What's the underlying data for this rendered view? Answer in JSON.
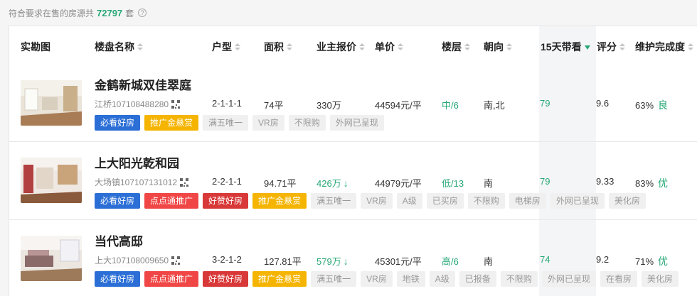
{
  "summary": {
    "prefix": "符合要求在售的房源共",
    "count": "72797",
    "suffix": "套",
    "help_icon": "?"
  },
  "columns": [
    {
      "label": "实勘图",
      "sortable": false
    },
    {
      "label": "楼盘名称",
      "sortable": true
    },
    {
      "label": "户型",
      "sortable": true
    },
    {
      "label": "面积",
      "sortable": true
    },
    {
      "label": "业主报价",
      "sortable": true
    },
    {
      "label": "单价",
      "sortable": true
    },
    {
      "label": "楼层",
      "sortable": true
    },
    {
      "label": "朝向",
      "sortable": true
    },
    {
      "label": "15天带看",
      "sortable": true,
      "active": true
    },
    {
      "label": "评分",
      "sortable": true
    },
    {
      "label": "维护完成度",
      "sortable": true
    }
  ],
  "listings": [
    {
      "name": "金鹤新城双佳翠庭",
      "code": "江桥107108488280",
      "layout": "2-1-1-1",
      "area": "74平",
      "price": "330万",
      "price_down": false,
      "unit_price": "44594元/平",
      "floor": "中/6",
      "orientation": "南,北",
      "views_15d": "79",
      "score": "9.6",
      "maintenance": "63%",
      "maintenance_grade": "良",
      "tags": [
        {
          "text": "必看好房",
          "style": "blue"
        },
        {
          "text": "推广金悬赏",
          "style": "yellow"
        },
        {
          "text": "满五唯一",
          "style": "gray"
        },
        {
          "text": "VR房",
          "style": "gray"
        },
        {
          "text": "不限购",
          "style": "gray"
        },
        {
          "text": "外网已呈现",
          "style": "gray"
        }
      ]
    },
    {
      "name": "上大阳光乾和园",
      "code": "大场镇107107131012",
      "layout": "2-2-1-1",
      "area": "94.71平",
      "price": "426万",
      "price_down": true,
      "unit_price": "44979元/平",
      "floor": "低/13",
      "orientation": "南",
      "views_15d": "79",
      "score": "9.33",
      "maintenance": "83%",
      "maintenance_grade": "优",
      "tags": [
        {
          "text": "必看好房",
          "style": "blue"
        },
        {
          "text": "点点通推广",
          "style": "red"
        },
        {
          "text": "好赞好房",
          "style": "dred"
        },
        {
          "text": "推广金悬赏",
          "style": "yellow"
        },
        {
          "text": "满五唯一",
          "style": "gray"
        },
        {
          "text": "VR房",
          "style": "gray"
        },
        {
          "text": "A级",
          "style": "gray"
        },
        {
          "text": "已买房",
          "style": "gray"
        },
        {
          "text": "不限购",
          "style": "gray"
        },
        {
          "text": "电梯房",
          "style": "gray"
        },
        {
          "text": "外网已呈现",
          "style": "gray"
        },
        {
          "text": "美化房",
          "style": "gray"
        }
      ]
    },
    {
      "name": "当代高邸",
      "code": "上大107108009650",
      "layout": "3-2-1-2",
      "area": "127.81平",
      "price": "579万",
      "price_down": true,
      "unit_price": "45301元/平",
      "floor": "高/6",
      "orientation": "南",
      "views_15d": "74",
      "score": "9.2",
      "maintenance": "71%",
      "maintenance_grade": "优",
      "tags": [
        {
          "text": "必看好房",
          "style": "blue"
        },
        {
          "text": "点点通推广",
          "style": "red"
        },
        {
          "text": "好赞好房",
          "style": "dred"
        },
        {
          "text": "推广金悬赏",
          "style": "yellow"
        },
        {
          "text": "满五唯一",
          "style": "gray"
        },
        {
          "text": "VR房",
          "style": "gray"
        },
        {
          "text": "地铁",
          "style": "gray"
        },
        {
          "text": "A级",
          "style": "gray"
        },
        {
          "text": "已报备",
          "style": "gray"
        },
        {
          "text": "不限购",
          "style": "gray"
        },
        {
          "text": "外网已呈现",
          "style": "gray"
        },
        {
          "text": "在看房",
          "style": "gray"
        },
        {
          "text": "美化房",
          "style": "gray"
        }
      ]
    }
  ],
  "colors": {
    "accent_green": "#27a876",
    "tag_blue": "#2b6fd6",
    "tag_red": "#f04646",
    "tag_dark_red": "#d93838",
    "tag_yellow": "#f5b400",
    "tag_gray_bg": "#f0f0f0"
  },
  "icons": {
    "help": "question-circle-icon",
    "sort": "sort-arrows-icon",
    "qr": "qr-code-icon",
    "price_down": "arrow-down-icon"
  }
}
